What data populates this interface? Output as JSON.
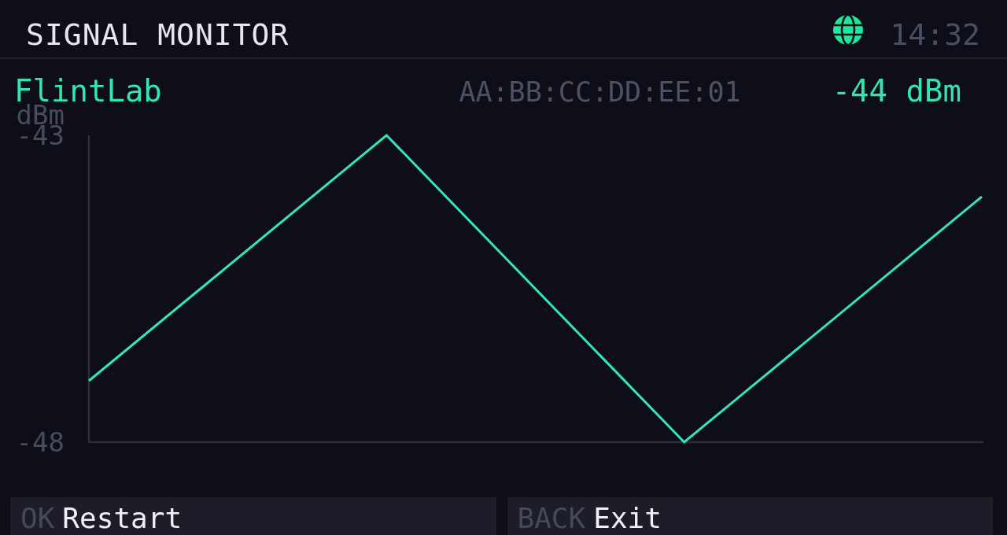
{
  "header": {
    "title": "SIGNAL MONITOR",
    "time": "14:32"
  },
  "device": {
    "name": "FlintLab",
    "mac": "AA:BB:CC:DD:EE:01",
    "rssi": "-44 dBm"
  },
  "chart": {
    "chart_data": {
      "type": "line",
      "ylabel": "dBm",
      "categories": [
        null,
        null,
        null,
        null
      ],
      "values": [
        -47,
        -43,
        -48,
        -44
      ],
      "ylim": [
        -48,
        -43
      ],
      "yticks": [
        {
          "value": -43,
          "label": "-43"
        },
        {
          "value": -48,
          "label": "-48"
        }
      ]
    }
  },
  "buttons": [
    {
      "key": "OK",
      "label": "Restart"
    },
    {
      "key": "BACK",
      "label": "Exit"
    }
  ]
}
